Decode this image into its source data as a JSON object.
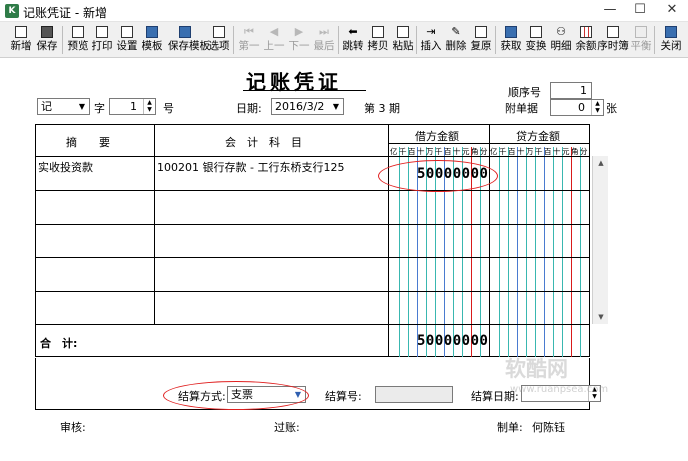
{
  "window": {
    "title": "记账凭证 - 新增",
    "controls": {
      "minimize": "—",
      "maximize": "☐",
      "close": "✕"
    }
  },
  "toolbar": [
    {
      "label": "新增",
      "icon": "new-doc-icon",
      "enabled": true
    },
    {
      "label": "保存",
      "icon": "save-icon",
      "enabled": true
    },
    {
      "label": "预览",
      "icon": "preview-icon",
      "enabled": true
    },
    {
      "label": "打印",
      "icon": "print-icon",
      "enabled": true
    },
    {
      "label": "设置",
      "icon": "page-setup-icon",
      "enabled": true
    },
    {
      "label": "模板",
      "icon": "template-icon",
      "enabled": true
    },
    {
      "label": "保存模板",
      "icon": "save-template-icon",
      "enabled": true
    },
    {
      "label": "选项",
      "icon": "options-icon",
      "enabled": true
    },
    {
      "label": "第一",
      "icon": "first-icon",
      "enabled": false
    },
    {
      "label": "上一",
      "icon": "prev-icon",
      "enabled": false
    },
    {
      "label": "下一",
      "icon": "next-icon",
      "enabled": false
    },
    {
      "label": "最后",
      "icon": "last-icon",
      "enabled": false
    },
    {
      "label": "跳转",
      "icon": "jump-icon",
      "enabled": true
    },
    {
      "label": "拷贝",
      "icon": "copy-icon",
      "enabled": true
    },
    {
      "label": "粘贴",
      "icon": "paste-icon",
      "enabled": true
    },
    {
      "label": "插入",
      "icon": "insert-row-icon",
      "enabled": true
    },
    {
      "label": "删除",
      "icon": "delete-row-icon",
      "enabled": true
    },
    {
      "label": "复原",
      "icon": "restore-icon",
      "enabled": true
    },
    {
      "label": "获取",
      "icon": "fetch-icon",
      "enabled": true
    },
    {
      "label": "变换",
      "icon": "transform-icon",
      "enabled": true
    },
    {
      "label": "明细",
      "icon": "detail-icon",
      "enabled": true
    },
    {
      "label": "余额",
      "icon": "balance-icon",
      "enabled": true
    },
    {
      "label": "序时簿",
      "icon": "journal-icon",
      "enabled": true
    },
    {
      "label": "平衡",
      "icon": "balance-check-icon",
      "enabled": false
    },
    {
      "label": "关闭",
      "icon": "exit-icon",
      "enabled": true
    }
  ],
  "voucher": {
    "title": "记账凭证",
    "word_value": "记",
    "word_label": "字",
    "number_value": "1",
    "number_label": "号",
    "date_label": "日期:",
    "date_value": "2016/3/2",
    "period_text": "第 3 期",
    "seq_label": "顺序号",
    "seq_value": "1",
    "attach_label": "附单据",
    "attach_value": "0",
    "attach_unit": "张"
  },
  "grid": {
    "headers": {
      "summary": "摘　　要",
      "account": "会　计　科　目",
      "debit": "借方金额",
      "credit": "贷方金额"
    },
    "digit_units": [
      "亿",
      "千",
      "百",
      "十",
      "万",
      "千",
      "百",
      "十",
      "元",
      "角",
      "分"
    ],
    "rows": [
      {
        "summary": "实收投资款",
        "account": "100201 银行存款 - 工行东桥支行125",
        "debit": "50000000",
        "credit": ""
      },
      {
        "summary": "",
        "account": "",
        "debit": "",
        "credit": ""
      },
      {
        "summary": "",
        "account": "",
        "debit": "",
        "credit": ""
      },
      {
        "summary": "",
        "account": "",
        "debit": "",
        "credit": ""
      },
      {
        "summary": "",
        "account": "",
        "debit": "",
        "credit": ""
      }
    ],
    "total_label": "合　计:",
    "total_debit": "50000000",
    "total_credit": ""
  },
  "settlement": {
    "method_label": "结算方式:",
    "method_value": "支票",
    "number_label": "结算号:",
    "number_value": "",
    "date_label": "结算日期:",
    "date_value": ""
  },
  "footer": {
    "audit_label": "审核:",
    "audit_value": "",
    "post_label": "过账:",
    "post_value": "",
    "maker_label": "制单:",
    "maker_value": "何陈钰"
  },
  "watermark": {
    "text": "软酷网",
    "url": "www.ruanpsea.com"
  },
  "colors": {
    "grid_teal": "#39b7b0",
    "grid_red": "#d91a1a",
    "highlight_red": "#e02020"
  }
}
